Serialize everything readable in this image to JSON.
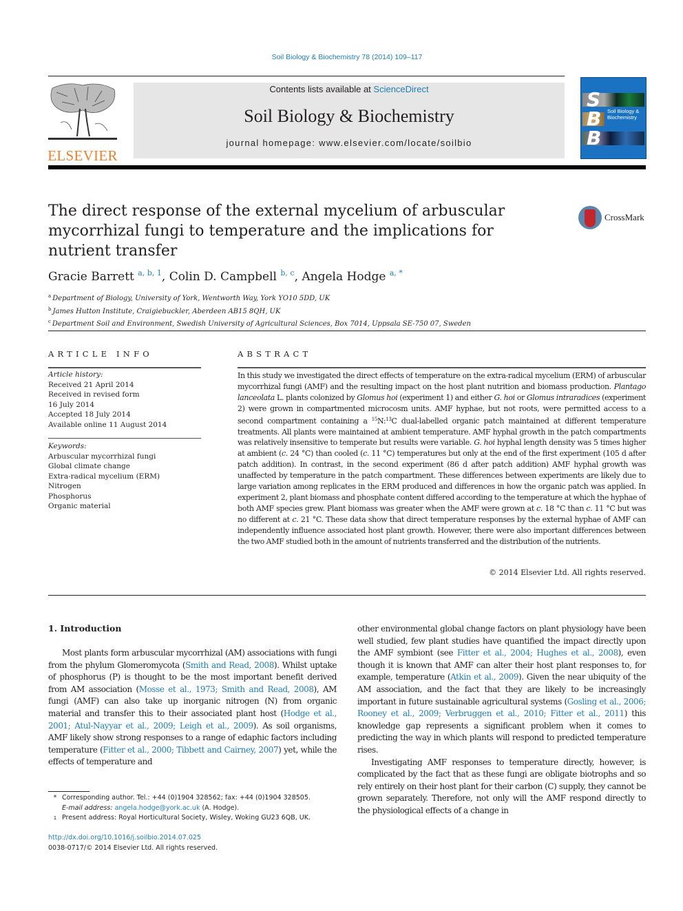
{
  "running_head": "Soil Biology & Biochemistry 78 (2014) 109–117",
  "masthead": {
    "publisher_logo_text": "ELSEVIER",
    "contents_prefix": "Contents lists available at ",
    "contents_link": "ScienceDirect",
    "journal_title": "Soil Biology & Biochemistry",
    "homepage": "journal homepage: www.elsevier.com/locate/soilbio",
    "cover": {
      "letters": [
        "S",
        "B",
        "B"
      ],
      "title_line1": "Soil Biology &",
      "title_line2": "Biochemistry",
      "background_color": "#1c72c2"
    }
  },
  "article": {
    "title": "The direct response of the external mycelium of arbuscular mycorrhizal fungi to temperature and the implications for nutrient transfer",
    "crossmark_label": "CrossMark",
    "authors": [
      {
        "name": "Gracie Barrett",
        "marks": "a, b, 1",
        "sep": ", "
      },
      {
        "name": "Colin D. Campbell",
        "marks": "b, c",
        "sep": ", "
      },
      {
        "name": "Angela Hodge",
        "marks": "a, *",
        "sep": ""
      }
    ],
    "affiliations": [
      {
        "mark": "a",
        "text": "Department of Biology, University of York, Wentworth Way, York YO10 5DD, UK"
      },
      {
        "mark": "b",
        "text": "James Hutton Institute, Craigiebuckler, Aberdeen AB15 8QH, UK"
      },
      {
        "mark": "c",
        "text": "Department Soil and Environment, Swedish University of Agricultural Sciences, Box 7014, Uppsala SE-750 07, Sweden"
      }
    ]
  },
  "article_info": {
    "heading": "ARTICLE INFO",
    "history_label": "Article history:",
    "history": [
      "Received 21 April 2014",
      "Received in revised form",
      "16 July 2014",
      "Accepted 18 July 2014",
      "Available online 11 August 2014"
    ],
    "keywords_label": "Keywords:",
    "keywords": [
      "Arbuscular mycorrhizal fungi",
      "Global climate change",
      "Extra-radical mycelium (ERM)",
      "Nitrogen",
      "Phosphorus",
      "Organic material"
    ]
  },
  "abstract": {
    "heading": "ABSTRACT",
    "segments": [
      {
        "t": "In this study we investigated the direct effects of temperature on the extra-radical mycelium (ERM) of arbuscular mycorrhizal fungi (AMF) and the resulting impact on the host plant nutrition and biomass production. "
      },
      {
        "t": "Plantago lanceolata",
        "i": true
      },
      {
        "t": " L. plants colonized by "
      },
      {
        "t": "Glomus hoi",
        "i": true
      },
      {
        "t": " (experiment 1) and either "
      },
      {
        "t": "G. hoi",
        "i": true
      },
      {
        "t": " or "
      },
      {
        "t": "Glomus intraradices",
        "i": true
      },
      {
        "t": " (experiment 2) were grown in compartmented microcosm units. AMF hyphae, but not roots, were permitted access to a second compartment containing a "
      },
      {
        "t": "15",
        "sup": true
      },
      {
        "t": "N:"
      },
      {
        "t": "13",
        "sup": true
      },
      {
        "t": "C dual-labelled organic patch maintained at different temperature treatments. All plants were maintained at ambient temper­ature. AMF hyphal growth in the patch compartments was relatively insensitive to temperate but results were variable. "
      },
      {
        "t": "G. hoi",
        "i": true
      },
      {
        "t": " hyphal length density was 5 times higher at ambient ("
      },
      {
        "t": "c.",
        "i": true
      },
      {
        "t": " 24 °C) than cooled ("
      },
      {
        "t": "c.",
        "i": true
      },
      {
        "t": " 11 °C) temperatures but only at the end of the first experiment (105 d after patch addition). In contrast, in the second experiment (86 d after patch addition) AMF hyphal growth was unaffected by temperature in the patch compartment. These differences between experiments are likely due to large variation among replicates in the ERM produced and differences in how the organic patch was applied. In experiment 2, plant biomass and phosphate content differed according to the temperature at which the hyphae of both AMF species grew. Plant biomass was greater when the AMF were grown at "
      },
      {
        "t": "c.",
        "i": true
      },
      {
        "t": " 18 °C than "
      },
      {
        "t": "c.",
        "i": true
      },
      {
        "t": " 11 °C but was no different at "
      },
      {
        "t": "c.",
        "i": true
      },
      {
        "t": " 21 °C. These data show that direct temperature responses by the external hyphae of AMF can independently influence associated host plant growth. However, there were also important differences between the two AMF studied both in the amount of nutrients transferred and the distri­bution of the nutrients."
      }
    ],
    "copyright": "© 2014 Elsevier Ltd. All rights reserved."
  },
  "body": {
    "section_heading": "1.  Introduction",
    "left_paragraph": [
      {
        "t": "Most plants form arbuscular mycorrhizal (AM) associations with fungi from the phylum Glomeromycota ("
      },
      {
        "t": "Smith and Read, 2008",
        "link": true
      },
      {
        "t": "). Whilst uptake of phosphorus (P) is thought to be the most impor­tant benefit derived from AM association ("
      },
      {
        "t": "Mosse et al., 1973; Smith and Read, 2008",
        "link": true
      },
      {
        "t": "), AM fungi (AMF) can also take up inorganic ni­trogen (N) from organic material and transfer this to their associ­ated plant host ("
      },
      {
        "t": "Hodge et al., 2001; Atul-Nayyar et al., 2009; Leigh et al., 2009",
        "link": true
      },
      {
        "t": "). As soil organisms, AMF likely show strong responses to a range of edaphic factors including temperature ("
      },
      {
        "t": "Fitter et al., 2000; Tibbett and Cairney, 2007",
        "link": true
      },
      {
        "t": ") yet, while the effects of temperature and"
      }
    ],
    "right_paragraph_1": [
      {
        "t": "other environmental global change factors on plant physiology have been well studied, few plant studies have quantified the impact directly upon the AMF symbiont (see "
      },
      {
        "t": "Fitter et al., 2004; Hughes et al., 2008",
        "link": true
      },
      {
        "t": "), even though it is known that AMF can alter their host plant responses to, for example, temperature ("
      },
      {
        "t": "Atkin et al., 2009",
        "link": true
      },
      {
        "t": "). Given the near ubiquity of the AM association, and the fact that they are likely to be increasingly important in future sustain­able agricultural systems ("
      },
      {
        "t": "Gosling et al., 2006; Rooney et al., 2009; Verbruggen et al., 2010; Fitter et al., 2011",
        "link": true
      },
      {
        "t": ") this knowledge gap represents a significant problem when it comes to predicting the way in which plants will respond to predicted temperature rises."
      }
    ],
    "right_paragraph_2": [
      {
        "t": "Investigating AMF responses to temperature directly, however, is complicated by the fact that as these fungi are obligate biotrophs and so rely entirely on their host plant for their carbon (C) supply, they cannot be grown separately. Therefore, not only will the AMF respond directly to the physiological effects of a change in"
      }
    ]
  },
  "footnotes": {
    "corresponding_mark": "*",
    "corresponding": "Corresponding author. Tel.: +44 (0)1904 328562; fax: +44 (0)1904 328505.",
    "email_label": "E-mail address: ",
    "email": "angela.hodge@york.ac.uk",
    "email_suffix": " (A. Hodge).",
    "present_mark": "1",
    "present_address": "Present address: Royal Horticultural Society, Wisley, Woking GU23 6QB, UK."
  },
  "doi": "http://dx.doi.org/10.1016/j.soilbio.2014.07.025",
  "issn_copyright": "0038-0717/© 2014 Elsevier Ltd. All rights reserved."
}
